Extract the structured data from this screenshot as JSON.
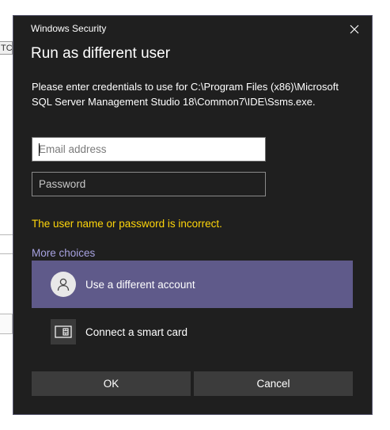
{
  "background": {
    "tab_fragment": "TC"
  },
  "dialog": {
    "app_title": "Windows Security",
    "heading": "Run as different user",
    "message": "Please enter credentials to use for C:\\Program Files (x86)\\Microsoft SQL Server Management Studio 18\\Common7\\IDE\\Ssms.exe.",
    "email_placeholder": "Email address",
    "password_placeholder": "Password",
    "error": "The user name or password is incorrect.",
    "more_choices": "More choices",
    "options": [
      {
        "label": "Use a different account",
        "icon": "user-icon",
        "selected": true
      },
      {
        "label": "Connect a smart card",
        "icon": "smart-card-icon",
        "selected": false
      }
    ],
    "ok_label": "OK",
    "cancel_label": "Cancel"
  },
  "colors": {
    "dialog_bg": "#1f1f1f",
    "error": "#ffd60a",
    "link": "#a7a2e0",
    "selected_option": "#5f5a8a",
    "button_bg": "#3c3c3c"
  }
}
